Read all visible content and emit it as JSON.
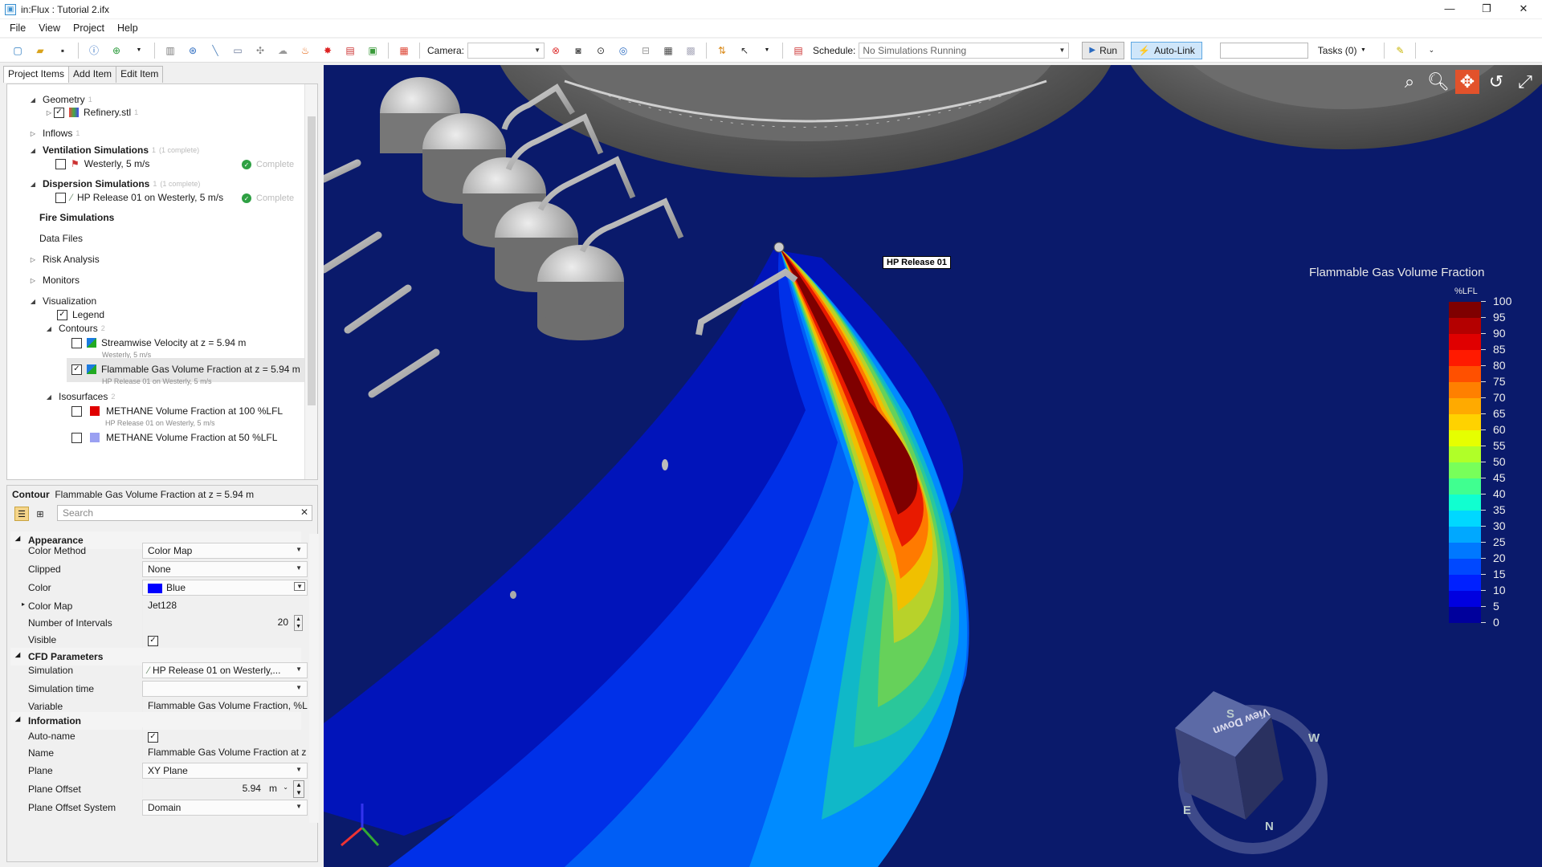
{
  "window": {
    "title": "in:Flux : Tutorial 2.ifx",
    "app_icon": "document-icon",
    "controls": [
      "—",
      "❐",
      "✕"
    ]
  },
  "menu": [
    "File",
    "View",
    "Project",
    "Help"
  ],
  "toolbar": {
    "camera_label": "Camera:",
    "camera_value": "",
    "schedule_label": "Schedule:",
    "schedule_value": "No Simulations Running",
    "run_label": "Run",
    "autolink_label": "Auto-Link",
    "tasks_label": "Tasks (0)"
  },
  "tabs": [
    "Project Items",
    "Add Item",
    "Edit Item"
  ],
  "tree": {
    "geometry": {
      "label": "Geometry",
      "count": "1"
    },
    "refinery": {
      "label": "Refinery.stl",
      "count": "1"
    },
    "inflows": {
      "label": "Inflows",
      "count": "1"
    },
    "ventilation": {
      "label": "Ventilation Simulations",
      "count": "1",
      "sub": "(1 complete)"
    },
    "westerly": {
      "label": "Westerly, 5 m/s",
      "status": "Complete"
    },
    "dispersion": {
      "label": "Dispersion Simulations",
      "count": "1",
      "sub": "(1 complete)"
    },
    "hp_release": {
      "label": "HP Release 01 on Westerly, 5 m/s",
      "status": "Complete"
    },
    "fire": {
      "label": "Fire Simulations"
    },
    "data_files": {
      "label": "Data Files"
    },
    "risk": {
      "label": "Risk Analysis"
    },
    "monitors": {
      "label": "Monitors"
    },
    "visualization": {
      "label": "Visualization"
    },
    "legend": {
      "label": "Legend"
    },
    "contours": {
      "label": "Contours",
      "count": "2"
    },
    "contour1": {
      "label": "Streamwise Velocity at z = 5.94 m",
      "sub": "Westerly, 5 m/s"
    },
    "contour2": {
      "label": "Flammable Gas Volume Fraction at z = 5.94 m",
      "sub": "HP Release 01 on Westerly, 5 m/s"
    },
    "isosurfaces": {
      "label": "Isosurfaces",
      "count": "2"
    },
    "iso1": {
      "label": "METHANE Volume Fraction at 100 %LFL",
      "sub": "HP Release 01 on Westerly, 5 m/s",
      "color": "#e00000"
    },
    "iso2": {
      "label": "METHANE Volume Fraction at 50 %LFL",
      "color": "#9aa0f2"
    }
  },
  "properties": {
    "header_type": "Contour",
    "header_name": "Flammable Gas Volume Fraction at z = 5.94 m",
    "search_placeholder": "Search",
    "appearance": "Appearance",
    "color_method": {
      "name": "Color Method",
      "value": "Color Map"
    },
    "clipped": {
      "name": "Clipped",
      "value": "None"
    },
    "color": {
      "name": "Color",
      "value": "Blue",
      "swatch": "#0000ff"
    },
    "color_map": {
      "name": "Color Map",
      "value": "Jet128"
    },
    "intervals": {
      "name": "Number of Intervals",
      "value": "20"
    },
    "visible": {
      "name": "Visible"
    },
    "cfd": "CFD Parameters",
    "simulation": {
      "name": "Simulation",
      "value": "HP Release 01 on Westerly,..."
    },
    "sim_time": {
      "name": "Simulation time",
      "value": ""
    },
    "variable": {
      "name": "Variable",
      "value": "Flammable Gas Volume Fraction, %LFL"
    },
    "information": "Information",
    "auto_name": {
      "name": "Auto-name"
    },
    "name": {
      "name": "Name",
      "value": "Flammable Gas Volume Fraction at z ="
    },
    "plane": {
      "name": "Plane",
      "value": "XY Plane"
    },
    "plane_offset": {
      "name": "Plane Offset",
      "value": "5.94",
      "unit": "m"
    },
    "plane_offset_system": {
      "name": "Plane Offset System",
      "value": "Domain"
    }
  },
  "viewport": {
    "release_label": "HP Release 01",
    "legend_title": "Flammable Gas Volume Fraction",
    "legend_unit": "%LFL",
    "legend_ticks": [
      "100",
      "95",
      "90",
      "85",
      "80",
      "75",
      "70",
      "65",
      "60",
      "55",
      "50",
      "45",
      "40",
      "35",
      "30",
      "25",
      "20",
      "15",
      "10",
      "5",
      "0"
    ],
    "legend_colors": [
      "#7f0000",
      "#b40000",
      "#e00000",
      "#ff1a00",
      "#ff5000",
      "#ff8000",
      "#ffaa00",
      "#ffd200",
      "#e6ff00",
      "#b0ff28",
      "#78ff5a",
      "#40ff90",
      "#10ffd0",
      "#00d8ff",
      "#00a8ff",
      "#0078ff",
      "#0048ff",
      "#0020ff",
      "#0000e0",
      "#00009c"
    ],
    "nav_cube_face": "View Down",
    "compass": [
      "N",
      "E",
      "S",
      "W"
    ]
  }
}
